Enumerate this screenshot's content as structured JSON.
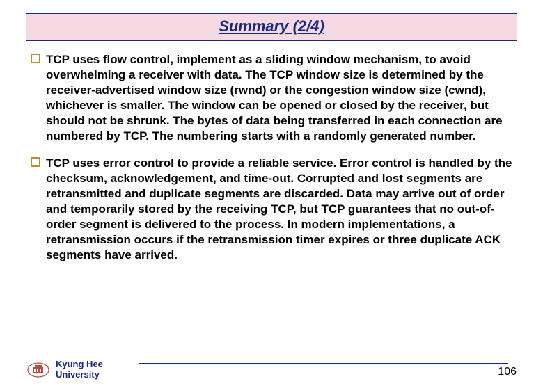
{
  "title": "Summary (2/4)",
  "bullets": [
    {
      "text": "TCP uses flow control, implement as a sliding window mechanism, to avoid overwhelming a receiver with data. The TCP window size is determined by the receiver-advertised window size (rwnd) or the congestion window size (cwnd), whichever is smaller. The window can be opened or closed by the receiver, but should not be shrunk. The bytes of data being transferred in each connection are numbered by TCP. The numbering starts with a randomly generated number."
    },
    {
      "text": "TCP uses error control to provide a reliable service. Error control is handled by the checksum, acknowledgement, and time-out. Corrupted and lost segments are retransmitted and duplicate segments are discarded. Data may arrive out of order and temporarily stored by the receiving TCP, but TCP guarantees that no out-of-order segment is delivered to the process. In modern implementations, a retransmission occurs if the retransmission timer expires or three duplicate ACK segments have arrived."
    }
  ],
  "footer": {
    "university_line1": "Kyung Hee",
    "university_line2": "University",
    "page_number": "106"
  },
  "colors": {
    "accent": "#1a2a7a",
    "title_bg": "#f6d9e3",
    "bullet_border": "#b38f35",
    "logo": "#b84a3a"
  }
}
